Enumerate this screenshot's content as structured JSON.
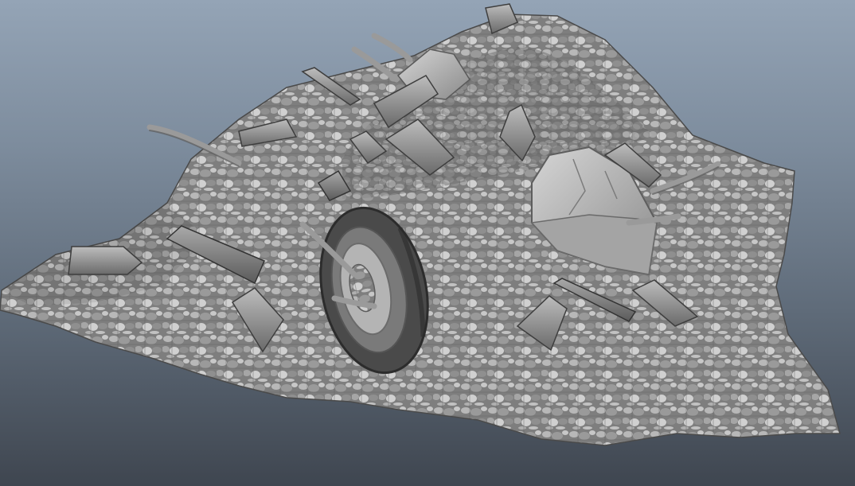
{
  "viewport": {
    "background_top_color": "#94a4b6",
    "background_bottom_color": "#3f4650"
  },
  "scene": {
    "rubble_color": "#8c8c8c",
    "objects": [
      "rubble-mound",
      "tire",
      "concrete-block",
      "wooden-plank",
      "stick"
    ]
  }
}
